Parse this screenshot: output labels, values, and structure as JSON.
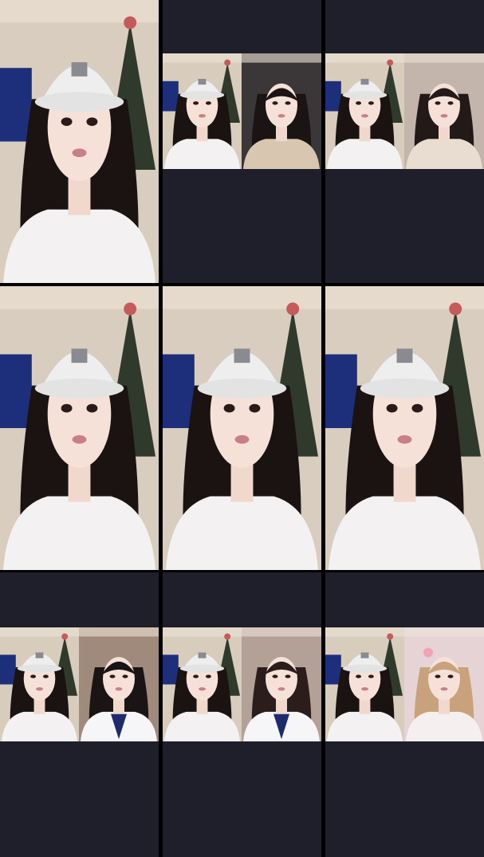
{
  "grid": {
    "columns": 3,
    "rows": 3,
    "background": "#000000",
    "cell_background": "#1f1f2b",
    "cells": [
      {
        "id": "r1c1",
        "layout": "single",
        "people": [
          {
            "hair": "#1b1311",
            "outfit": "#f3f1f2",
            "cap": true,
            "bg": "#d9cdbf",
            "tree": true,
            "monitor": true
          }
        ]
      },
      {
        "id": "r1c2",
        "layout": "split",
        "people": [
          {
            "hair": "#1b1311",
            "outfit": "#f3f1f2",
            "cap": true,
            "bg": "#d8ccbd",
            "tree": true,
            "monitor": true
          },
          {
            "hair": "#1a1414",
            "outfit": "#d8c6b0",
            "cap": false,
            "bg": "#3b3638",
            "tree": false,
            "monitor": false
          }
        ]
      },
      {
        "id": "r1c3",
        "layout": "split",
        "people": [
          {
            "hair": "#1b1311",
            "outfit": "#f3f1f2",
            "cap": true,
            "bg": "#d8ccbd",
            "tree": true,
            "monitor": true
          },
          {
            "hair": "#221918",
            "outfit": "#e9ddd2",
            "cap": false,
            "bg": "#c3b5ab",
            "tree": false,
            "monitor": false
          }
        ]
      },
      {
        "id": "r2c1",
        "layout": "single",
        "people": [
          {
            "hair": "#1b1311",
            "outfit": "#f3f1f2",
            "cap": true,
            "bg": "#d9cdbf",
            "tree": true,
            "monitor": true
          }
        ]
      },
      {
        "id": "r2c2",
        "layout": "single",
        "people": [
          {
            "hair": "#1b1311",
            "outfit": "#f3f1f2",
            "cap": true,
            "bg": "#d9cdbf",
            "tree": true,
            "monitor": true
          }
        ]
      },
      {
        "id": "r2c3",
        "layout": "single",
        "people": [
          {
            "hair": "#1b1311",
            "outfit": "#f3f1f2",
            "cap": true,
            "bg": "#d9cdbf",
            "tree": true,
            "monitor": true
          }
        ]
      },
      {
        "id": "r3c1",
        "layout": "split",
        "people": [
          {
            "hair": "#1b1311",
            "outfit": "#f3f1f2",
            "cap": true,
            "bg": "#d8ccbd",
            "tree": true,
            "monitor": true
          },
          {
            "hair": "#1a1414",
            "outfit": "#f6f6f8",
            "cap": false,
            "bg": "#a08a7c",
            "tree": false,
            "monitor": false,
            "tie": "#1d2a6e"
          }
        ]
      },
      {
        "id": "r3c2",
        "layout": "split",
        "people": [
          {
            "hair": "#1b1311",
            "outfit": "#f3f1f2",
            "cap": true,
            "bg": "#d8ccbd",
            "tree": true,
            "monitor": true
          },
          {
            "hair": "#2a1d1b",
            "outfit": "#f6f6f8",
            "cap": false,
            "bg": "#b3a197",
            "tree": false,
            "monitor": false,
            "tie": "#1d2a6e"
          }
        ]
      },
      {
        "id": "r3c3",
        "layout": "split",
        "people": [
          {
            "hair": "#1b1311",
            "outfit": "#f3f1f2",
            "cap": true,
            "bg": "#d8ccbd",
            "tree": true,
            "monitor": true
          },
          {
            "hair": "#c8a27c",
            "outfit": "#f5eff0",
            "cap": false,
            "bg": "#e6d3d6",
            "tree": false,
            "monitor": false,
            "bow": "#f1a3b6"
          }
        ]
      }
    ]
  }
}
